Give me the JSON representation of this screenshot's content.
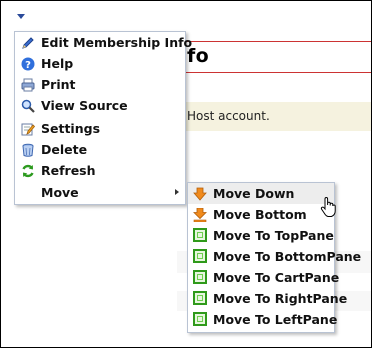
{
  "page": {
    "title_text": "fo",
    "info_text": "Host account."
  },
  "menu": {
    "items": [
      {
        "label": "Edit Membership Info",
        "icon": "pencil-icon"
      },
      {
        "label": "Help",
        "icon": "help-icon"
      },
      {
        "label": "Print",
        "icon": "print-icon"
      },
      {
        "label": "View Source",
        "icon": "magnifier-icon"
      },
      {
        "label": "Settings",
        "icon": "settings-icon"
      },
      {
        "label": "Delete",
        "icon": "trash-icon"
      },
      {
        "label": "Refresh",
        "icon": "refresh-icon"
      },
      {
        "label": "Move",
        "icon": "none",
        "has_submenu": true
      }
    ]
  },
  "submenu": {
    "items": [
      {
        "label": "Move Down",
        "icon": "arrow-down-icon",
        "highlighted": true
      },
      {
        "label": "Move Bottom",
        "icon": "arrow-bottom-icon"
      },
      {
        "label": "Move To TopPane",
        "icon": "pane-icon"
      },
      {
        "label": "Move To BottomPane",
        "icon": "pane-icon"
      },
      {
        "label": "Move To CartPane",
        "icon": "pane-icon"
      },
      {
        "label": "Move To RightPane",
        "icon": "pane-icon"
      },
      {
        "label": "Move To LeftPane",
        "icon": "pane-icon"
      }
    ]
  },
  "colors": {
    "accent_blue": "#2a4a9a",
    "pane_green": "#2f9a1a",
    "arrow_orange": "#f08a1c",
    "info_bg": "#f5f2df",
    "title_border": "#cc3333"
  }
}
